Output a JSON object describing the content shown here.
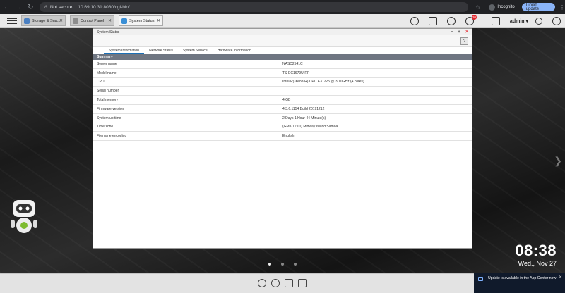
{
  "browser": {
    "back": "←",
    "forward": "→",
    "reload": "↻",
    "security": "Not secure",
    "url": "10.69.10.31:8080/cgi-bin/",
    "incognito_label": "Incognito",
    "finish_update": "Finish update"
  },
  "taskbar": {
    "tabs": [
      {
        "label": "Storage & Sna...",
        "icon_color": "#4a7fc1"
      },
      {
        "label": "Control Panel",
        "icon_color": "#8c8c8c"
      },
      {
        "label": "System Status",
        "icon_color": "#3a8fd6"
      }
    ],
    "notification_count": "10",
    "user": "admin ▾"
  },
  "window": {
    "title": "System Status",
    "help": "?",
    "tabs": [
      "System Information",
      "Network Status",
      "System Service",
      "Hardware Information"
    ],
    "section": "Summary",
    "rows": [
      {
        "key": "Server name",
        "value": "NASD2541C"
      },
      {
        "key": "Model name",
        "value": "TS-EC1679U-RP"
      },
      {
        "key": "CPU",
        "value": "Intel(R) Xeon(R) CPU E31225 @ 3.10GHz (4 cores)"
      },
      {
        "key": "Serial number",
        "value": ""
      },
      {
        "key": "Total memory",
        "value": "4 GB"
      },
      {
        "key": "Firmware version",
        "value": "4.3.6.1154 Build 20191212"
      },
      {
        "key": "System up time",
        "value": "2 Days 1 Hour 44 Minute(s)"
      },
      {
        "key": "Time zone",
        "value": "(GMT-11:00) Midway Island,Samoa"
      },
      {
        "key": "Filename encoding",
        "value": "English"
      }
    ]
  },
  "desktop": {
    "time": "08:38",
    "date": "Wed., Nov 27"
  },
  "notification": {
    "text": "Update is available in the App Center now"
  },
  "colors": {
    "accent": "#1b6fb5",
    "close": "#e4262c",
    "summary_bar": "#6f7682"
  }
}
